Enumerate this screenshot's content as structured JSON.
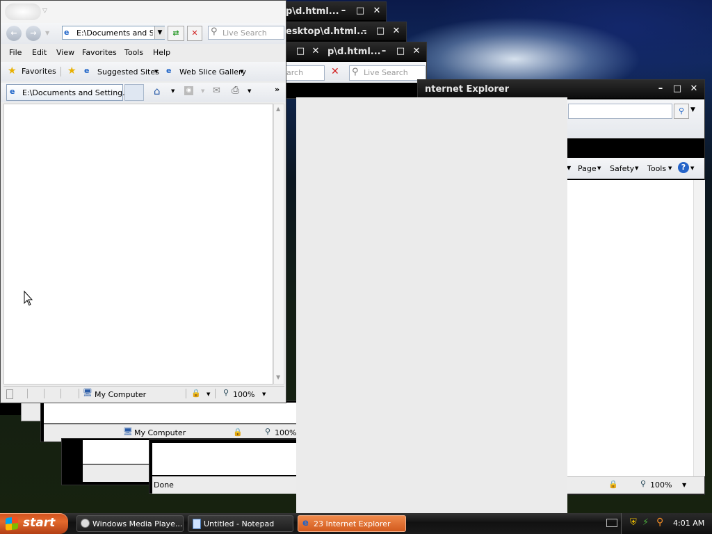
{
  "desktop": {},
  "back_windows": {
    "w1_title": "p\\d.html...",
    "w2_title": "esktop\\d.html...",
    "w3_title": "p\\d.html...",
    "w3_search_placeholder": "Live Search",
    "w3_search_partial": "arch",
    "ie_main_title": "nternet Explorer",
    "ie_main_cmd": {
      "page": "Page",
      "safety": "Safety",
      "tools": "Tools"
    },
    "ie_main_zoom": "100%",
    "w5_zone": "My Computer",
    "w5_zoom": "100%",
    "done_text": "Done"
  },
  "front_window": {
    "address": "E:\\Documents and Set",
    "search_placeholder": "Live Search",
    "menu": [
      "File",
      "Edit",
      "View",
      "Favorites",
      "Tools",
      "Help"
    ],
    "favorites_label": "Favorites",
    "suggested_sites": "Suggested Sites",
    "web_slice_gallery": "Web Slice Gallery",
    "tab_title": "E:\\Documents and Setting...",
    "status_zone": "My Computer",
    "zoom": "100%"
  },
  "taskbar": {
    "start_label": "start",
    "items": [
      "Windows Media Playe...",
      "Untitled - Notepad",
      "23 Internet Explorer"
    ],
    "clock": "4:01 AM"
  },
  "colors": {
    "taskbar_active": "#e0601f",
    "start_orange": "#d2521f",
    "ie_blue": "#1e64c8"
  }
}
